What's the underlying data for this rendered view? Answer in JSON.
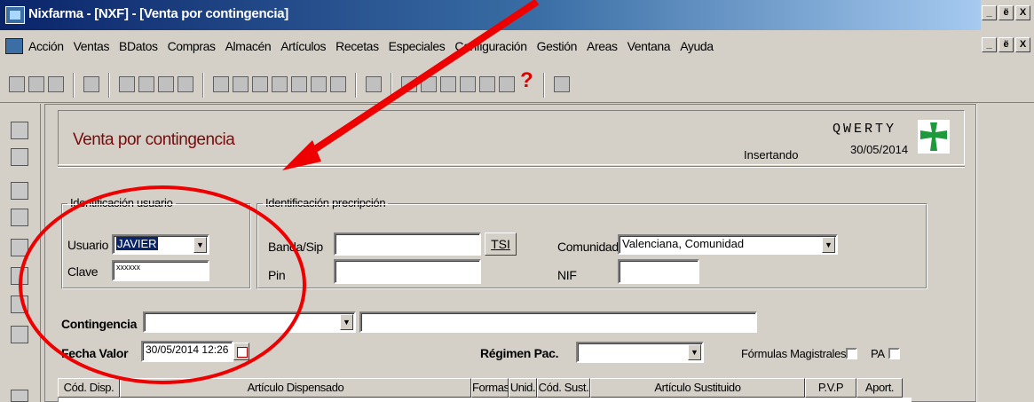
{
  "window": {
    "title": "Nixfarma - [NXF] - [Venta por contingencia]",
    "buttons": [
      "_",
      "ё",
      "X"
    ]
  },
  "menu": {
    "items": [
      "Acción",
      "Ventas",
      "BDatos",
      "Compras",
      "Almacén",
      "Artículos",
      "Recetas",
      "Especiales",
      "Configuración",
      "Gestión",
      "Areas",
      "Ventana",
      "Ayuda"
    ],
    "mdi_buttons": [
      "_",
      "ё",
      "X"
    ]
  },
  "toolbar": {
    "help_label": "?"
  },
  "form": {
    "title": "Venta por contingencia",
    "status": "Insertando",
    "company": "QWERTY",
    "date": "30/05/2014"
  },
  "user_group": {
    "legend": "Identificación usuario",
    "usuario_label": "Usuario",
    "usuario_value": "JAVIER",
    "clave_label": "Clave",
    "clave_value": "xxxxxx"
  },
  "prescription_group": {
    "legend": "Identificación precripción",
    "banda_label": "Banda/Sip",
    "banda_value": "",
    "tsi_button": "TSI",
    "pin_label": "Pin",
    "pin_value": "",
    "comunidad_label": "Comunidad",
    "comunidad_value": "Valenciana, Comunidad",
    "nif_label": "NIF",
    "nif_value": ""
  },
  "contingencia": {
    "label": "Contingencia",
    "value": "",
    "description": ""
  },
  "fecha": {
    "label": "Fecha Valor",
    "value": "30/05/2014 12:26"
  },
  "regimen": {
    "label": "Régimen Pac.",
    "value": ""
  },
  "checks": {
    "formulas_label": "Fórmulas Magistrales",
    "pa_label": "PA"
  },
  "grid": {
    "columns": [
      "Cód. Disp.",
      "Artículo Dispensado",
      "Formas",
      "Unid.",
      "Cód. Sust.",
      "Artículo Sustituido",
      "P.V.P",
      "Aport."
    ]
  },
  "annotation": {
    "colors": {
      "arrow": "#ee0000",
      "circle": "#ee0000"
    }
  },
  "colors": {
    "title_bar": "#0a246a",
    "form_title": "#7a0a0a",
    "selection": "#0a246a",
    "cross": "#1e9a3c"
  }
}
